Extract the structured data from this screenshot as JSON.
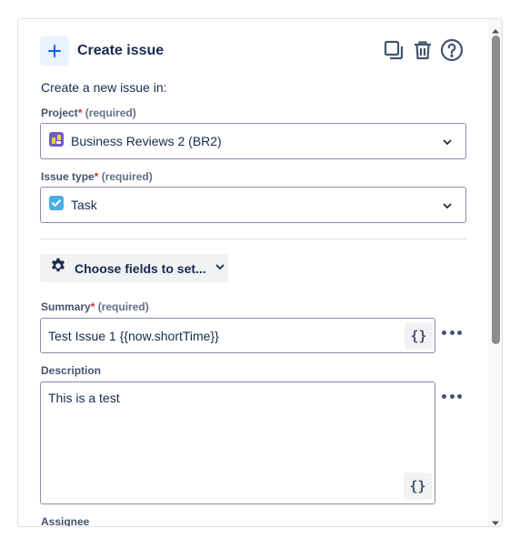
{
  "header": {
    "title": "Create issue",
    "icons": [
      "plus-icon",
      "copy-icon",
      "trash-icon",
      "help-icon"
    ]
  },
  "intro": "Create a new issue in:",
  "project": {
    "label": "Project",
    "required": "(required)",
    "value": "Business Reviews 2 (BR2)"
  },
  "issue_type": {
    "label": "Issue type",
    "required": "(required)",
    "value": "Task"
  },
  "choose_fields": {
    "label": "Choose fields to set..."
  },
  "summary": {
    "label": "Summary",
    "required": "(required)",
    "value": "Test Issue 1 {{now.shortTime}}",
    "braces": "{}"
  },
  "description": {
    "label": "Description",
    "value": "This is a test",
    "braces": "{}"
  },
  "assignee": {
    "label": "Assignee"
  },
  "star": "*",
  "colors": {
    "accent": "#0c66e4",
    "text": "#172b4d",
    "required_star": "#c9372c",
    "border": "#8590a2"
  }
}
